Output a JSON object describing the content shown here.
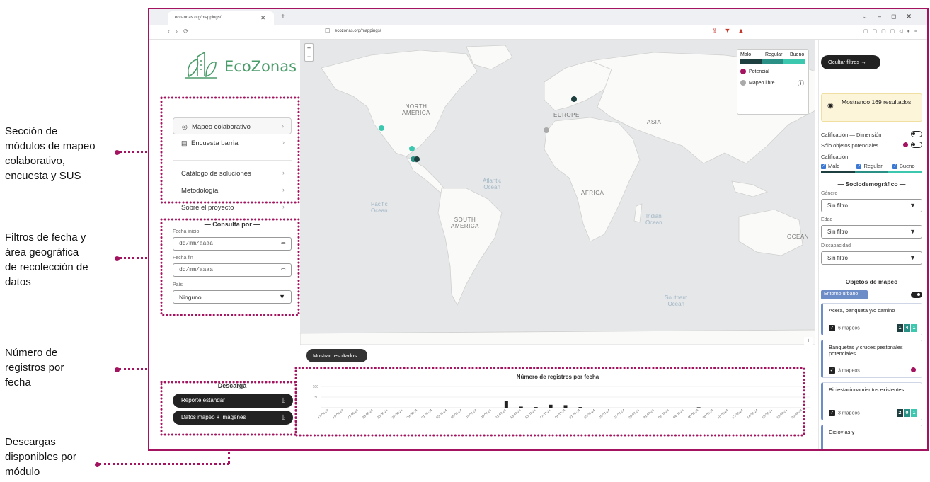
{
  "annotations": [
    {
      "id": "a1",
      "lines": [
        "Sección de",
        "módulos de mapeo",
        "colaborativo,",
        "encuesta y SUS"
      ]
    },
    {
      "id": "a2",
      "lines": [
        "Filtros de fecha y",
        "área geográfica",
        "de recolección de",
        "datos"
      ]
    },
    {
      "id": "a3",
      "lines": [
        "Número de",
        "registros por",
        "fecha"
      ]
    },
    {
      "id": "a4",
      "lines": [
        "Descargas",
        "disponibles por",
        "módulo"
      ]
    }
  ],
  "browser": {
    "tab_title": "ecozonas.org/mappings/",
    "url": "ecozonas.org/mappings/"
  },
  "brand": {
    "name": "EcoZonas",
    "color": "#4a9c6a"
  },
  "accent_color": "#a3135f",
  "menu": {
    "items": [
      {
        "label": "Mapeo colaborativo",
        "icon": "map-pin-icon"
      },
      {
        "label": "Encuesta barrial",
        "icon": "survey-icon"
      },
      {
        "label": "Catálogo de soluciones",
        "icon": ""
      },
      {
        "label": "Metodología",
        "icon": ""
      },
      {
        "label": "Sobre el proyecto",
        "icon": ""
      }
    ]
  },
  "filters": {
    "section_title": "— Consulta por —",
    "start_label": "Fecha inicio",
    "start_placeholder": "dd/mm/aaaa",
    "end_label": "Fecha fin",
    "end_placeholder": "dd/mm/aaaa",
    "country_label": "País",
    "country_value": "Ninguno"
  },
  "downloads": {
    "section_title": "— Descarga —",
    "buttons": [
      "Reporte estándar",
      "Datos mapeo + imágenes"
    ]
  },
  "map": {
    "labels": [
      {
        "text": "NORTH\nAMERICA",
        "kind": "continent"
      },
      {
        "text": "EUROPE",
        "kind": "continent"
      },
      {
        "text": "ASIA",
        "kind": "continent"
      },
      {
        "text": "AFRICA",
        "kind": "continent"
      },
      {
        "text": "SOUTH\nAMERICA",
        "kind": "continent"
      },
      {
        "text": "Atlantic\nOcean",
        "kind": "ocean"
      },
      {
        "text": "Pacific\nOcean",
        "kind": "ocean"
      },
      {
        "text": "Indian\nOcean",
        "kind": "ocean"
      },
      {
        "text": "Southern\nOcean",
        "kind": "ocean"
      },
      {
        "text": "OCEAN",
        "kind": "continent"
      }
    ],
    "legend": {
      "grades": [
        "Malo",
        "Regular",
        "Bueno"
      ],
      "grade_colors": [
        "#1e3f3f",
        "#2a8f84",
        "#3cc8ae"
      ],
      "potencial_label": "Potencial",
      "potencial_color": "#a3135f",
      "libre_label": "Mapeo libre",
      "libre_color": "#aaaaaa"
    },
    "results_button": "Mostrar resultados"
  },
  "chart_data": {
    "type": "bar",
    "title": "Número de registros por fecha",
    "ylim": [
      0,
      100
    ],
    "ytick_labels": [
      "100",
      "50"
    ],
    "categories": [
      "17-06-24",
      "19-06-24",
      "21-06-24",
      "23-06-24",
      "25-06-24",
      "27-06-24",
      "29-06-24",
      "01-07-24",
      "03-07-24",
      "05-07-24",
      "07-07-24",
      "09-07-24",
      "11-07-24",
      "13-07-24",
      "15-07-24",
      "17-07-24",
      "19-07-24",
      "21-07-24",
      "23-07-24",
      "25-07-24",
      "27-07-24",
      "29-07-24",
      "31-07-24",
      "02-08-24",
      "04-08-24",
      "06-08-24",
      "08-08-24",
      "10-08-24",
      "12-08-24",
      "14-08-24",
      "16-08-24",
      "18-08-24",
      "20-08-24"
    ],
    "values": [
      0,
      0,
      0,
      0,
      0,
      0,
      0,
      0,
      0,
      0,
      0,
      0,
      30,
      5,
      3,
      14,
      12,
      3,
      0,
      0,
      0,
      0,
      0,
      0,
      0,
      2,
      0,
      0,
      0,
      0,
      0,
      0,
      0
    ]
  },
  "rpanel": {
    "hide_filters": "Ocultar filtros",
    "showing_text": "Mostrando 169 resultados",
    "calif_dim_label": "Calificación — Dimensión",
    "solo_potenciales_label": "Sólo objetos potenciales",
    "calificacion_label": "Calificación",
    "checks": [
      "Malo",
      "Regular",
      "Bueno"
    ],
    "socio_title": "— Sociodemográfico —",
    "genero_label": "Género",
    "genero_value": "Sin filtro",
    "edad_label": "Edad",
    "edad_value": "Sin filtro",
    "disc_label": "Discapacidad",
    "disc_value": "Sin filtro",
    "objetos_title": "— Objetos de mapeo —",
    "entorno_label": "Entorno urbano",
    "cards": [
      {
        "title": "Acera, banqueta y/o camino",
        "count": "6 mapeos",
        "badges": [
          "1",
          "4",
          "1"
        ]
      },
      {
        "title": "Banquetas y cruces peatonales potenciales",
        "count": "3 mapeos",
        "badges": []
      },
      {
        "title": "Biciestacionamientos existentes",
        "count": "3 mapeos",
        "badges": [
          "2",
          "0",
          "1"
        ]
      },
      {
        "title": "Ciclovías y",
        "count": "",
        "badges": []
      }
    ]
  }
}
